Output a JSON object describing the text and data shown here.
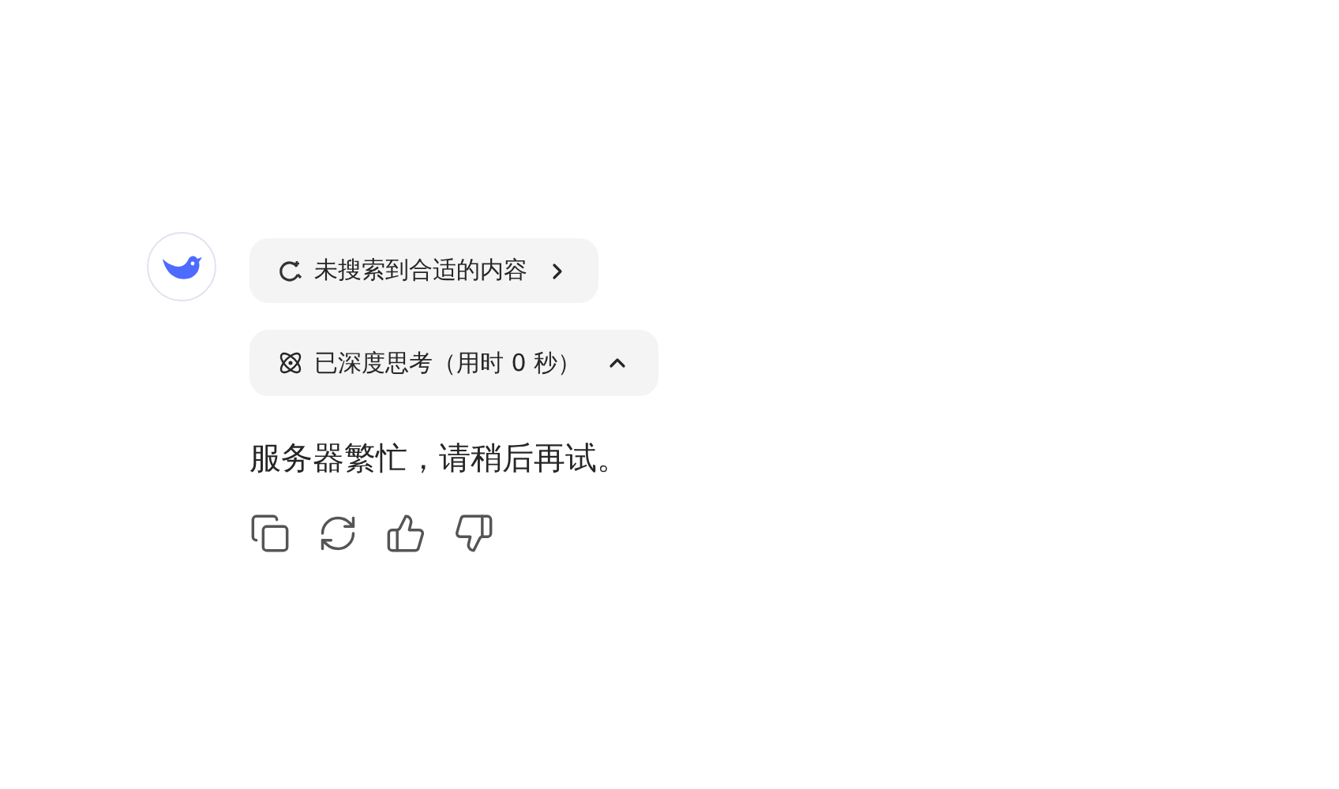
{
  "search_status": {
    "label": "未搜索到合适的内容"
  },
  "thinking": {
    "label": "已深度思考（用时 0 秒）",
    "expanded": true
  },
  "message": "服务器繁忙，请稍后再试。"
}
